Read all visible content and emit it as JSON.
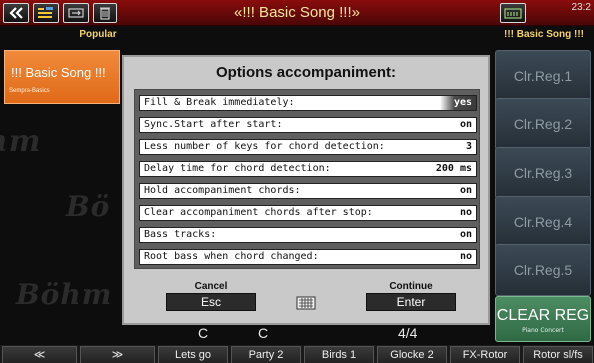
{
  "topbar": {
    "title": "«!!! Basic Song !!!»",
    "clock": "23:2",
    "icons": [
      "back-double-chevron-icon",
      "menu-icon",
      "usb-icon",
      "trash-icon",
      "registration-icon"
    ]
  },
  "subbar": {
    "left": "Popular",
    "right": "!!! Basic Song !!!"
  },
  "song_tile": {
    "name": "!!! Basic Song !!!",
    "sub": "Sempra-Basics"
  },
  "watermark": "Böhm",
  "registrations": [
    {
      "label": "Clr.Reg.1"
    },
    {
      "label": "Clr.Reg.2"
    },
    {
      "label": "Clr.Reg.3"
    },
    {
      "label": "Clr.Reg.4"
    },
    {
      "label": "Clr.Reg.5"
    }
  ],
  "clear_reg": {
    "label": "CLEAR REG",
    "sub": "Piano Concert"
  },
  "info": {
    "chord1": "C",
    "chord2": "C",
    "meter": "4/4"
  },
  "tabs": [
    {
      "label": "≪"
    },
    {
      "label": "≫"
    },
    {
      "label": "Lets go"
    },
    {
      "label": "Party 2"
    },
    {
      "label": "Birds 1"
    },
    {
      "label": "Glocke 2"
    },
    {
      "label": "FX-Rotor"
    },
    {
      "label": "Rotor sl/fs"
    }
  ],
  "dialog": {
    "title": "Options accompaniment:",
    "options": [
      {
        "label": "Fill & Break immediately:",
        "value": "yes",
        "selected": true
      },
      {
        "label": "Sync.Start after start:",
        "value": "on"
      },
      {
        "label": "Less number of keys for chord detection:",
        "value": "3"
      },
      {
        "label": "Delay time for chord detection:",
        "value": "200 ms"
      },
      {
        "label": "Hold accompaniment chords:",
        "value": "on"
      },
      {
        "label": "Clear accompaniment chords after stop:",
        "value": "no"
      },
      {
        "label": "Bass tracks:",
        "value": "on"
      },
      {
        "label": "Root bass when chord changed:",
        "value": "no"
      }
    ],
    "cancel_caption": "Cancel",
    "cancel_key": "Esc",
    "continue_caption": "Continue",
    "continue_key": "Enter"
  }
}
